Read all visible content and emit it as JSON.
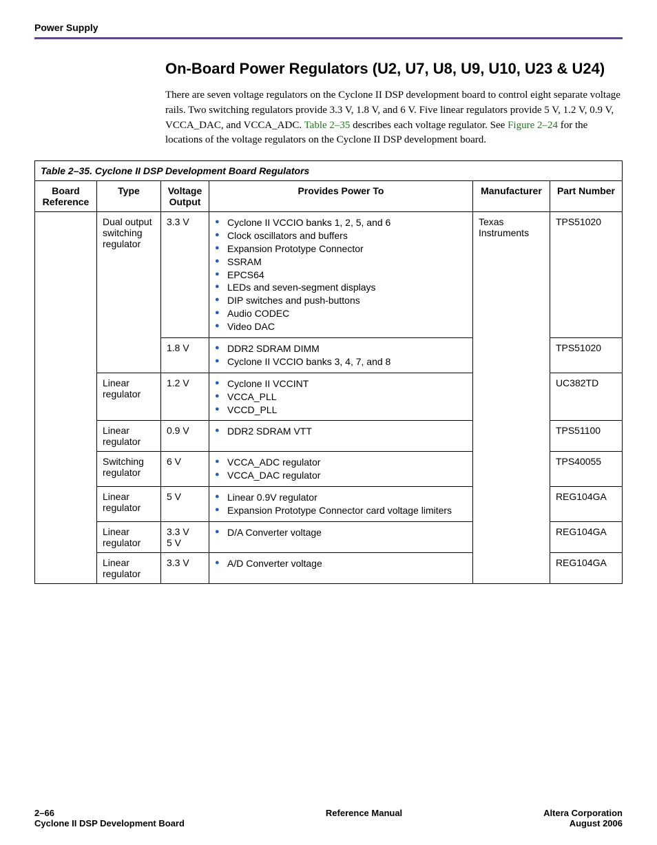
{
  "header": {
    "running_head": "Power Supply"
  },
  "section": {
    "title": "On-Board Power Regulators (U2, U7, U8, U9, U10, U23 & U24)",
    "intro_before_link1": "There are seven voltage regulators on the Cyclone II DSP development board to control eight separate voltage rails. Two switching regulators provide 3.3 V, 1.8 V, and 6 V. Five linear regulators provide 5 V, 1.2 V, 0.9 V, VCCA_DAC, and VCCA_ADC. ",
    "link1": "Table 2–35",
    "intro_mid": " describes each voltage regulator. See ",
    "link2": "Figure 2–24",
    "intro_after_link2": " for the locations of the voltage regulators on the Cyclone II DSP development board."
  },
  "table": {
    "caption": "Table 2–35.  Cyclone II DSP Development Board Regulators",
    "headers": {
      "c1": "Board Reference",
      "c2": "Type",
      "c3": "Voltage Output",
      "c4": "Provides Power To",
      "c5": "Manufacturer",
      "c6": "Part Number"
    },
    "rows": {
      "r1": {
        "type": "Dual output switching regulator",
        "voltage": "3.3 V",
        "bullets": [
          "Cyclone II VCCIO banks 1, 2, 5, and 6",
          "Clock oscillators and buffers",
          "Expansion Prototype Connector",
          "SSRAM",
          "EPCS64",
          "LEDs and seven-segment displays",
          "DIP switches and push-buttons",
          "Audio CODEC",
          "Video DAC"
        ],
        "manufacturer": "Texas Instruments",
        "part": "TPS51020"
      },
      "r2": {
        "voltage": "1.8 V",
        "bullets": [
          "DDR2 SDRAM DIMM",
          "Cyclone II VCCIO banks 3, 4, 7, and 8"
        ],
        "part": "TPS51020"
      },
      "r3": {
        "type": "Linear regulator",
        "voltage": "1.2 V",
        "bullets": [
          "Cyclone II VCCINT",
          "VCCA_PLL",
          "VCCD_PLL"
        ],
        "part": "UC382TD"
      },
      "r4": {
        "type": "Linear regulator",
        "voltage": "0.9 V",
        "bullets": [
          "DDR2 SDRAM VTT"
        ],
        "part": "TPS51100"
      },
      "r5": {
        "type": "Switching regulator",
        "voltage": "6 V",
        "bullets": [
          "VCCA_ADC regulator",
          "VCCA_DAC regulator"
        ],
        "part": "TPS40055"
      },
      "r6": {
        "type": "Linear regulator",
        "voltage": "5 V",
        "bullets": [
          "Linear 0.9V regulator",
          "Expansion Prototype Connector card voltage limiters"
        ],
        "part": "REG104GA"
      },
      "r7": {
        "type": "Linear regulator",
        "voltage_a": "3.3 V",
        "voltage_b": "5 V",
        "bullets": [
          "D/A Converter voltage"
        ],
        "part": "REG104GA"
      },
      "r8": {
        "type": "Linear regulator",
        "voltage": "3.3 V",
        "bullets": [
          "A/D Converter voltage"
        ],
        "part": "REG104GA"
      }
    }
  },
  "footer": {
    "page_num": "2–66",
    "doc_title": "Cyclone II DSP Development Board",
    "center": "Reference Manual",
    "company": "Altera Corporation",
    "date": "August 2006"
  }
}
